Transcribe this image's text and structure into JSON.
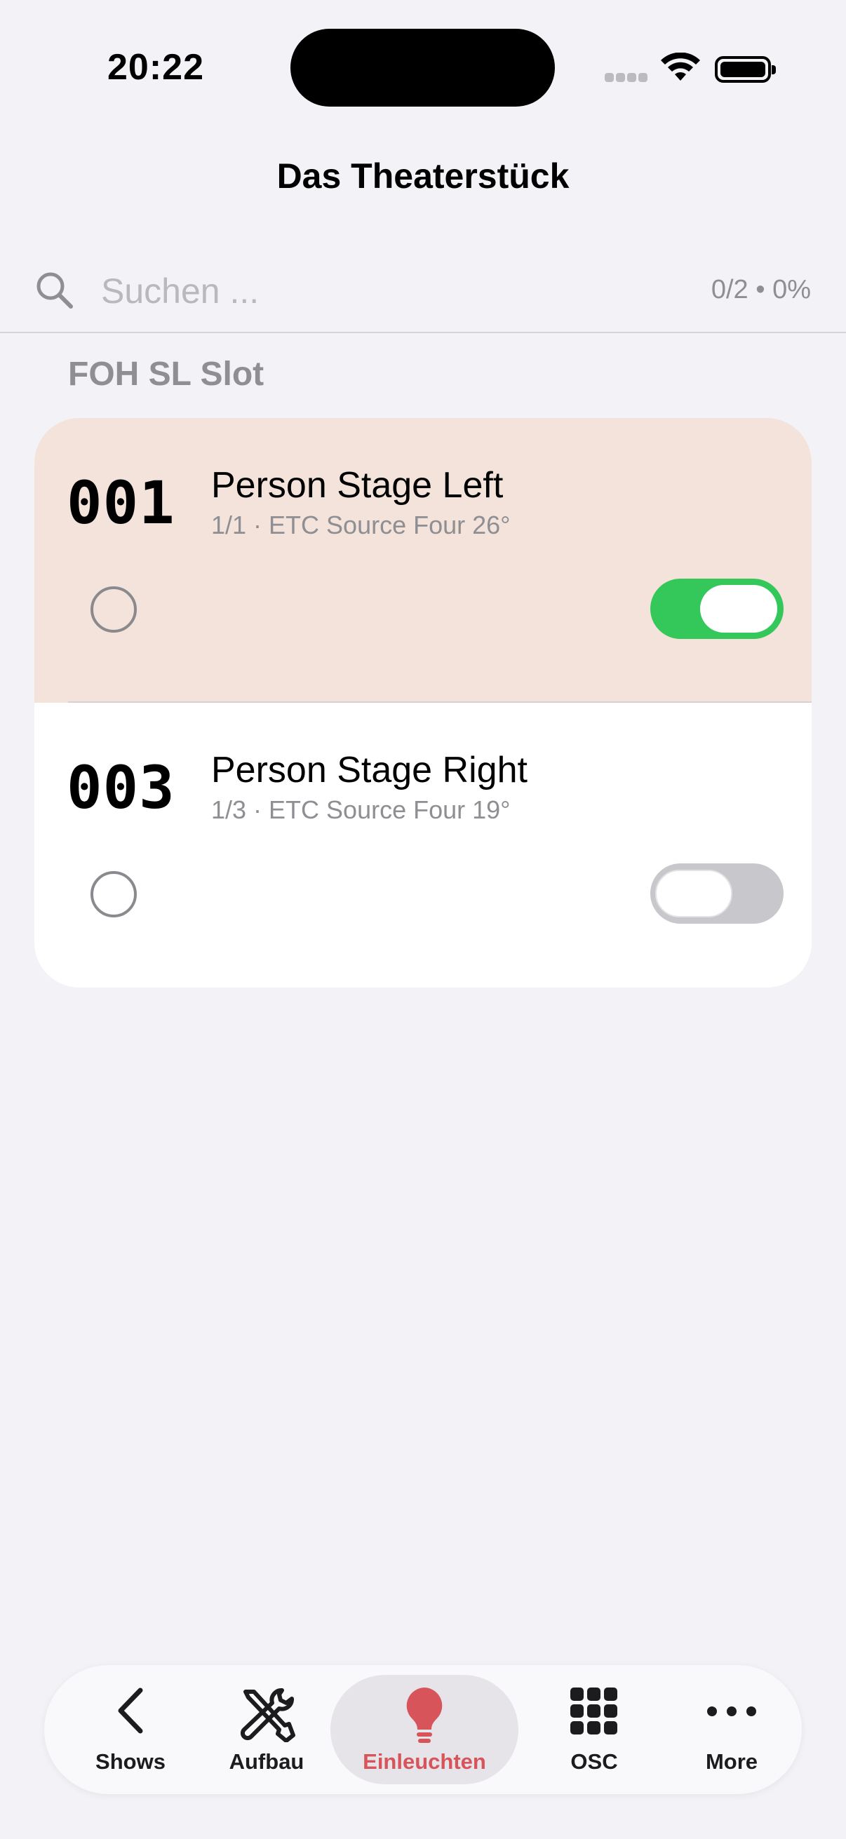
{
  "status_bar": {
    "time": "20:22"
  },
  "header": {
    "title": "Das Theaterstück"
  },
  "search": {
    "placeholder": "Suchen ...",
    "value": "",
    "progress": "0/2 • 0%"
  },
  "section": {
    "title": "FOH SL Slot"
  },
  "items": [
    {
      "number": "001",
      "name": "Person Stage Left",
      "detail": "1/1 · ETC Source Four 26°",
      "checked": false,
      "toggle_on": true,
      "highlighted": true
    },
    {
      "number": "003",
      "name": "Person Stage Right",
      "detail": "1/3 · ETC Source Four 19°",
      "checked": false,
      "toggle_on": false,
      "highlighted": false
    }
  ],
  "tab_bar": {
    "tabs": [
      {
        "label": "Shows",
        "icon": "chevron-left-icon"
      },
      {
        "label": "Aufbau",
        "icon": "wrench-screwdriver-icon"
      },
      {
        "label": "Einleuchten",
        "icon": "lightbulb-icon",
        "active": true
      },
      {
        "label": "OSC",
        "icon": "grid-icon"
      },
      {
        "label": "More",
        "icon": "ellipsis-icon"
      }
    ]
  },
  "colors": {
    "accent_active_tab": "#d6545a",
    "toggle_on": "#34c759",
    "highlight_row": "#f3e3da",
    "background": "#f2f2f7"
  }
}
